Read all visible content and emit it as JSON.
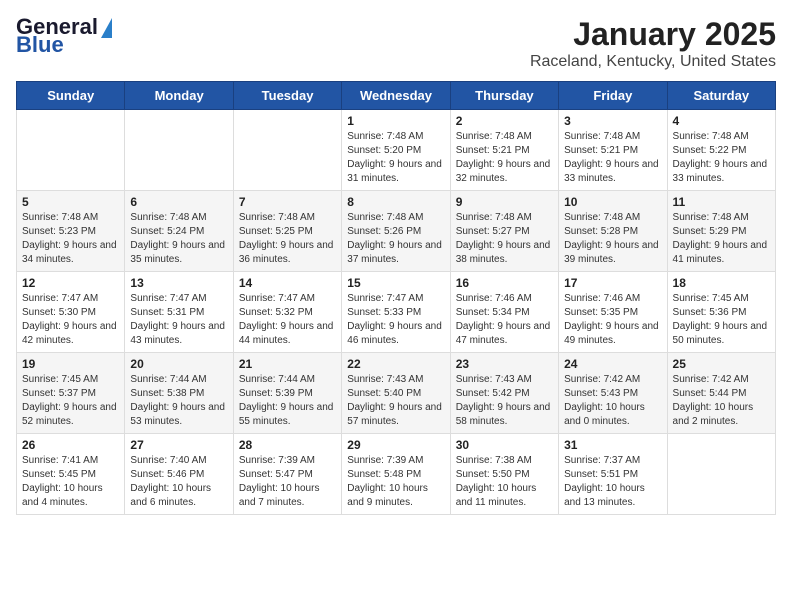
{
  "header": {
    "logo_line1": "General",
    "logo_line2": "Blue",
    "title": "January 2025",
    "subtitle": "Raceland, Kentucky, United States"
  },
  "days_of_week": [
    "Sunday",
    "Monday",
    "Tuesday",
    "Wednesday",
    "Thursday",
    "Friday",
    "Saturday"
  ],
  "weeks": [
    [
      {
        "day": "",
        "info": ""
      },
      {
        "day": "",
        "info": ""
      },
      {
        "day": "",
        "info": ""
      },
      {
        "day": "1",
        "info": "Sunrise: 7:48 AM\nSunset: 5:20 PM\nDaylight: 9 hours and 31 minutes."
      },
      {
        "day": "2",
        "info": "Sunrise: 7:48 AM\nSunset: 5:21 PM\nDaylight: 9 hours and 32 minutes."
      },
      {
        "day": "3",
        "info": "Sunrise: 7:48 AM\nSunset: 5:21 PM\nDaylight: 9 hours and 33 minutes."
      },
      {
        "day": "4",
        "info": "Sunrise: 7:48 AM\nSunset: 5:22 PM\nDaylight: 9 hours and 33 minutes."
      }
    ],
    [
      {
        "day": "5",
        "info": "Sunrise: 7:48 AM\nSunset: 5:23 PM\nDaylight: 9 hours and 34 minutes."
      },
      {
        "day": "6",
        "info": "Sunrise: 7:48 AM\nSunset: 5:24 PM\nDaylight: 9 hours and 35 minutes."
      },
      {
        "day": "7",
        "info": "Sunrise: 7:48 AM\nSunset: 5:25 PM\nDaylight: 9 hours and 36 minutes."
      },
      {
        "day": "8",
        "info": "Sunrise: 7:48 AM\nSunset: 5:26 PM\nDaylight: 9 hours and 37 minutes."
      },
      {
        "day": "9",
        "info": "Sunrise: 7:48 AM\nSunset: 5:27 PM\nDaylight: 9 hours and 38 minutes."
      },
      {
        "day": "10",
        "info": "Sunrise: 7:48 AM\nSunset: 5:28 PM\nDaylight: 9 hours and 39 minutes."
      },
      {
        "day": "11",
        "info": "Sunrise: 7:48 AM\nSunset: 5:29 PM\nDaylight: 9 hours and 41 minutes."
      }
    ],
    [
      {
        "day": "12",
        "info": "Sunrise: 7:47 AM\nSunset: 5:30 PM\nDaylight: 9 hours and 42 minutes."
      },
      {
        "day": "13",
        "info": "Sunrise: 7:47 AM\nSunset: 5:31 PM\nDaylight: 9 hours and 43 minutes."
      },
      {
        "day": "14",
        "info": "Sunrise: 7:47 AM\nSunset: 5:32 PM\nDaylight: 9 hours and 44 minutes."
      },
      {
        "day": "15",
        "info": "Sunrise: 7:47 AM\nSunset: 5:33 PM\nDaylight: 9 hours and 46 minutes."
      },
      {
        "day": "16",
        "info": "Sunrise: 7:46 AM\nSunset: 5:34 PM\nDaylight: 9 hours and 47 minutes."
      },
      {
        "day": "17",
        "info": "Sunrise: 7:46 AM\nSunset: 5:35 PM\nDaylight: 9 hours and 49 minutes."
      },
      {
        "day": "18",
        "info": "Sunrise: 7:45 AM\nSunset: 5:36 PM\nDaylight: 9 hours and 50 minutes."
      }
    ],
    [
      {
        "day": "19",
        "info": "Sunrise: 7:45 AM\nSunset: 5:37 PM\nDaylight: 9 hours and 52 minutes."
      },
      {
        "day": "20",
        "info": "Sunrise: 7:44 AM\nSunset: 5:38 PM\nDaylight: 9 hours and 53 minutes."
      },
      {
        "day": "21",
        "info": "Sunrise: 7:44 AM\nSunset: 5:39 PM\nDaylight: 9 hours and 55 minutes."
      },
      {
        "day": "22",
        "info": "Sunrise: 7:43 AM\nSunset: 5:40 PM\nDaylight: 9 hours and 57 minutes."
      },
      {
        "day": "23",
        "info": "Sunrise: 7:43 AM\nSunset: 5:42 PM\nDaylight: 9 hours and 58 minutes."
      },
      {
        "day": "24",
        "info": "Sunrise: 7:42 AM\nSunset: 5:43 PM\nDaylight: 10 hours and 0 minutes."
      },
      {
        "day": "25",
        "info": "Sunrise: 7:42 AM\nSunset: 5:44 PM\nDaylight: 10 hours and 2 minutes."
      }
    ],
    [
      {
        "day": "26",
        "info": "Sunrise: 7:41 AM\nSunset: 5:45 PM\nDaylight: 10 hours and 4 minutes."
      },
      {
        "day": "27",
        "info": "Sunrise: 7:40 AM\nSunset: 5:46 PM\nDaylight: 10 hours and 6 minutes."
      },
      {
        "day": "28",
        "info": "Sunrise: 7:39 AM\nSunset: 5:47 PM\nDaylight: 10 hours and 7 minutes."
      },
      {
        "day": "29",
        "info": "Sunrise: 7:39 AM\nSunset: 5:48 PM\nDaylight: 10 hours and 9 minutes."
      },
      {
        "day": "30",
        "info": "Sunrise: 7:38 AM\nSunset: 5:50 PM\nDaylight: 10 hours and 11 minutes."
      },
      {
        "day": "31",
        "info": "Sunrise: 7:37 AM\nSunset: 5:51 PM\nDaylight: 10 hours and 13 minutes."
      },
      {
        "day": "",
        "info": ""
      }
    ]
  ]
}
